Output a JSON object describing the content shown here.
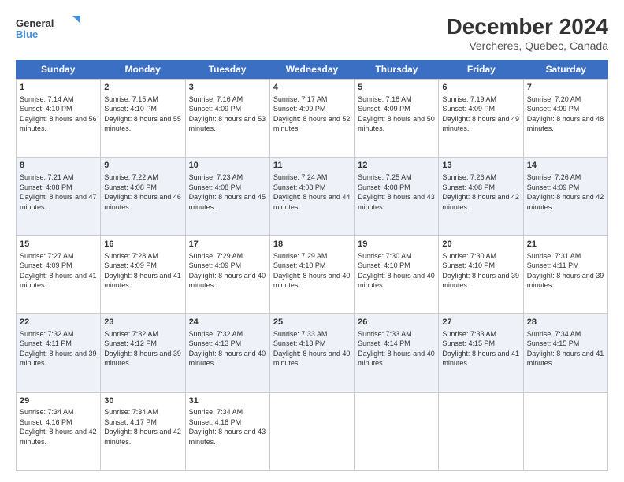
{
  "logo": {
    "line1": "General",
    "line2": "Blue"
  },
  "title": "December 2024",
  "subtitle": "Vercheres, Quebec, Canada",
  "weekdays": [
    "Sunday",
    "Monday",
    "Tuesday",
    "Wednesday",
    "Thursday",
    "Friday",
    "Saturday"
  ],
  "rows": [
    [
      {
        "day": "1",
        "sunrise": "Sunrise: 7:14 AM",
        "sunset": "Sunset: 4:10 PM",
        "daylight": "Daylight: 8 hours and 56 minutes."
      },
      {
        "day": "2",
        "sunrise": "Sunrise: 7:15 AM",
        "sunset": "Sunset: 4:10 PM",
        "daylight": "Daylight: 8 hours and 55 minutes."
      },
      {
        "day": "3",
        "sunrise": "Sunrise: 7:16 AM",
        "sunset": "Sunset: 4:09 PM",
        "daylight": "Daylight: 8 hours and 53 minutes."
      },
      {
        "day": "4",
        "sunrise": "Sunrise: 7:17 AM",
        "sunset": "Sunset: 4:09 PM",
        "daylight": "Daylight: 8 hours and 52 minutes."
      },
      {
        "day": "5",
        "sunrise": "Sunrise: 7:18 AM",
        "sunset": "Sunset: 4:09 PM",
        "daylight": "Daylight: 8 hours and 50 minutes."
      },
      {
        "day": "6",
        "sunrise": "Sunrise: 7:19 AM",
        "sunset": "Sunset: 4:09 PM",
        "daylight": "Daylight: 8 hours and 49 minutes."
      },
      {
        "day": "7",
        "sunrise": "Sunrise: 7:20 AM",
        "sunset": "Sunset: 4:09 PM",
        "daylight": "Daylight: 8 hours and 48 minutes."
      }
    ],
    [
      {
        "day": "8",
        "sunrise": "Sunrise: 7:21 AM",
        "sunset": "Sunset: 4:08 PM",
        "daylight": "Daylight: 8 hours and 47 minutes."
      },
      {
        "day": "9",
        "sunrise": "Sunrise: 7:22 AM",
        "sunset": "Sunset: 4:08 PM",
        "daylight": "Daylight: 8 hours and 46 minutes."
      },
      {
        "day": "10",
        "sunrise": "Sunrise: 7:23 AM",
        "sunset": "Sunset: 4:08 PM",
        "daylight": "Daylight: 8 hours and 45 minutes."
      },
      {
        "day": "11",
        "sunrise": "Sunrise: 7:24 AM",
        "sunset": "Sunset: 4:08 PM",
        "daylight": "Daylight: 8 hours and 44 minutes."
      },
      {
        "day": "12",
        "sunrise": "Sunrise: 7:25 AM",
        "sunset": "Sunset: 4:08 PM",
        "daylight": "Daylight: 8 hours and 43 minutes."
      },
      {
        "day": "13",
        "sunrise": "Sunrise: 7:26 AM",
        "sunset": "Sunset: 4:08 PM",
        "daylight": "Daylight: 8 hours and 42 minutes."
      },
      {
        "day": "14",
        "sunrise": "Sunrise: 7:26 AM",
        "sunset": "Sunset: 4:09 PM",
        "daylight": "Daylight: 8 hours and 42 minutes."
      }
    ],
    [
      {
        "day": "15",
        "sunrise": "Sunrise: 7:27 AM",
        "sunset": "Sunset: 4:09 PM",
        "daylight": "Daylight: 8 hours and 41 minutes."
      },
      {
        "day": "16",
        "sunrise": "Sunrise: 7:28 AM",
        "sunset": "Sunset: 4:09 PM",
        "daylight": "Daylight: 8 hours and 41 minutes."
      },
      {
        "day": "17",
        "sunrise": "Sunrise: 7:29 AM",
        "sunset": "Sunset: 4:09 PM",
        "daylight": "Daylight: 8 hours and 40 minutes."
      },
      {
        "day": "18",
        "sunrise": "Sunrise: 7:29 AM",
        "sunset": "Sunset: 4:10 PM",
        "daylight": "Daylight: 8 hours and 40 minutes."
      },
      {
        "day": "19",
        "sunrise": "Sunrise: 7:30 AM",
        "sunset": "Sunset: 4:10 PM",
        "daylight": "Daylight: 8 hours and 40 minutes."
      },
      {
        "day": "20",
        "sunrise": "Sunrise: 7:30 AM",
        "sunset": "Sunset: 4:10 PM",
        "daylight": "Daylight: 8 hours and 39 minutes."
      },
      {
        "day": "21",
        "sunrise": "Sunrise: 7:31 AM",
        "sunset": "Sunset: 4:11 PM",
        "daylight": "Daylight: 8 hours and 39 minutes."
      }
    ],
    [
      {
        "day": "22",
        "sunrise": "Sunrise: 7:32 AM",
        "sunset": "Sunset: 4:11 PM",
        "daylight": "Daylight: 8 hours and 39 minutes."
      },
      {
        "day": "23",
        "sunrise": "Sunrise: 7:32 AM",
        "sunset": "Sunset: 4:12 PM",
        "daylight": "Daylight: 8 hours and 39 minutes."
      },
      {
        "day": "24",
        "sunrise": "Sunrise: 7:32 AM",
        "sunset": "Sunset: 4:13 PM",
        "daylight": "Daylight: 8 hours and 40 minutes."
      },
      {
        "day": "25",
        "sunrise": "Sunrise: 7:33 AM",
        "sunset": "Sunset: 4:13 PM",
        "daylight": "Daylight: 8 hours and 40 minutes."
      },
      {
        "day": "26",
        "sunrise": "Sunrise: 7:33 AM",
        "sunset": "Sunset: 4:14 PM",
        "daylight": "Daylight: 8 hours and 40 minutes."
      },
      {
        "day": "27",
        "sunrise": "Sunrise: 7:33 AM",
        "sunset": "Sunset: 4:15 PM",
        "daylight": "Daylight: 8 hours and 41 minutes."
      },
      {
        "day": "28",
        "sunrise": "Sunrise: 7:34 AM",
        "sunset": "Sunset: 4:15 PM",
        "daylight": "Daylight: 8 hours and 41 minutes."
      }
    ],
    [
      {
        "day": "29",
        "sunrise": "Sunrise: 7:34 AM",
        "sunset": "Sunset: 4:16 PM",
        "daylight": "Daylight: 8 hours and 42 minutes."
      },
      {
        "day": "30",
        "sunrise": "Sunrise: 7:34 AM",
        "sunset": "Sunset: 4:17 PM",
        "daylight": "Daylight: 8 hours and 42 minutes."
      },
      {
        "day": "31",
        "sunrise": "Sunrise: 7:34 AM",
        "sunset": "Sunset: 4:18 PM",
        "daylight": "Daylight: 8 hours and 43 minutes."
      },
      null,
      null,
      null,
      null
    ]
  ]
}
